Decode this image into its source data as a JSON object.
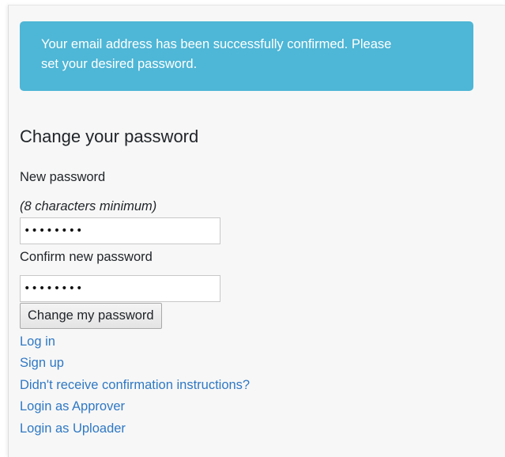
{
  "alert": {
    "line1": "Your email address has been successfully confirmed. Please",
    "line2": "set your desired password."
  },
  "form": {
    "title": "Change your password",
    "new_password_label": "New password",
    "new_password_hint": "(8 characters minimum)",
    "new_password_value": "••••••••",
    "confirm_password_label": "Confirm new password",
    "confirm_password_value": "••••••••",
    "submit_label": "Change my password"
  },
  "links": {
    "log_in": "Log in",
    "sign_up": "Sign up",
    "confirmation": "Didn't receive confirmation instructions?",
    "approver": "Login as Approver",
    "uploader": "Login as Uploader"
  },
  "colors": {
    "alert_background": "#4eb6d6",
    "link": "#2f78c4",
    "panel_background": "#f7f7f7"
  }
}
